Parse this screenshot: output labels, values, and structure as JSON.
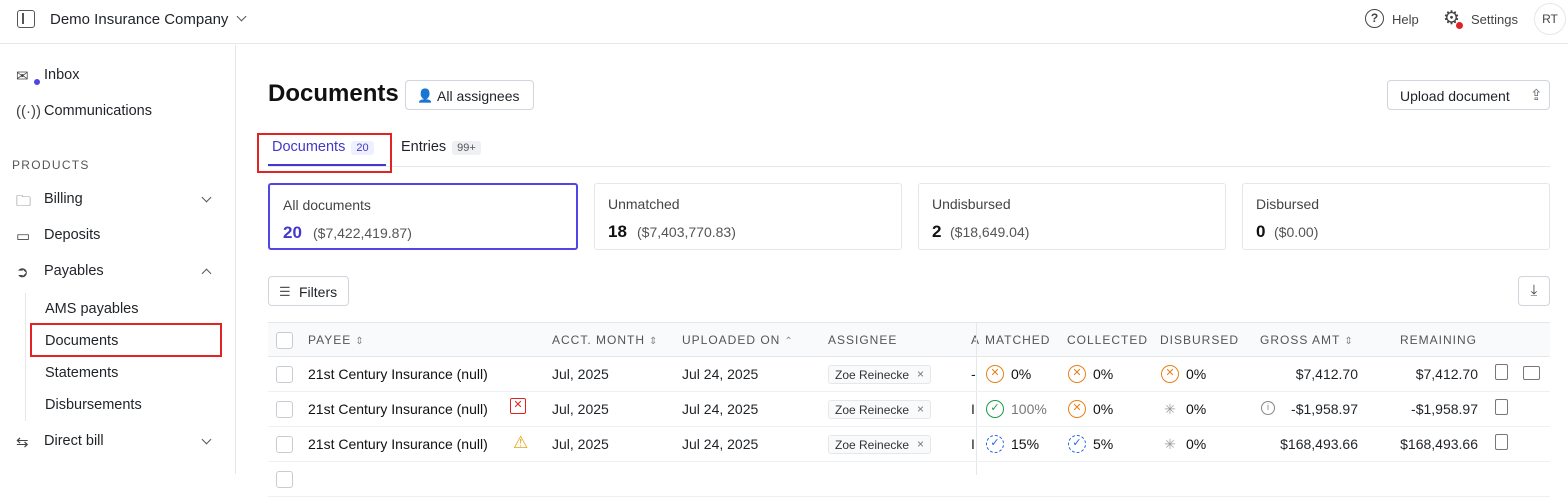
{
  "topbar": {
    "company": "Demo Insurance Company",
    "help": "Help",
    "settings": "Settings",
    "avatar": "RT"
  },
  "sidebar": {
    "inbox": "Inbox",
    "communications": "Communications",
    "section_products": "PRODUCTS",
    "billing": "Billing",
    "deposits": "Deposits",
    "payables": "Payables",
    "payables_sub": [
      "AMS payables",
      "Documents",
      "Statements",
      "Disbursements"
    ],
    "direct_bill": "Direct bill"
  },
  "page": {
    "title": "Documents",
    "assignee_filter": "All assignees",
    "upload_button": "Upload document"
  },
  "tabs": [
    {
      "label": "Documents",
      "count": "20"
    },
    {
      "label": "Entries",
      "count": "99+"
    }
  ],
  "stat_cards": [
    {
      "title": "All documents",
      "count": "20",
      "amount": "($7,422,419.87)"
    },
    {
      "title": "Unmatched",
      "count": "18",
      "amount": "($7,403,770.83)"
    },
    {
      "title": "Undisbursed",
      "count": "2",
      "amount": "($18,649.04)"
    },
    {
      "title": "Disbursed",
      "count": "0",
      "amount": "($0.00)"
    }
  ],
  "toolbar": {
    "filters": "Filters"
  },
  "table": {
    "headers": {
      "payee": "PAYEE",
      "acct_month": "ACCT. MONTH",
      "uploaded_on": "UPLOADED ON",
      "assignee": "ASSIGNEE",
      "truncated": "A",
      "matched": "MATCHED",
      "collected": "COLLECTED",
      "disbursed": "DISBURSED",
      "gross_amt": "GROSS AMT",
      "remaining": "REMAINING"
    },
    "rows": [
      {
        "payee": "21st Century Insurance (null)",
        "acct_month": "Jul, 2025",
        "uploaded_on": "Jul 24, 2025",
        "assignee": "Zoe Reinecke",
        "trunc": "-",
        "matched": "0%",
        "collected": "0%",
        "disbursed": "0%",
        "gross": "$7,412.70",
        "remaining": "$7,412.70"
      },
      {
        "payee": "21st Century Insurance (null)",
        "acct_month": "Jul, 2025",
        "uploaded_on": "Jul 24, 2025",
        "assignee": "Zoe Reinecke",
        "trunc": "I",
        "matched": "100%",
        "collected": "0%",
        "disbursed": "0%",
        "gross": "-$1,958.97",
        "remaining": "-$1,958.97"
      },
      {
        "payee": "21st Century Insurance (null)",
        "acct_month": "Jul, 2025",
        "uploaded_on": "Jul 24, 2025",
        "assignee": "Zoe Reinecke",
        "trunc": "I",
        "matched": "15%",
        "collected": "5%",
        "disbursed": "0%",
        "gross": "$168,493.66",
        "remaining": "$168,493.66"
      }
    ]
  },
  "colors": {
    "accent": "#4338ca",
    "highlight": "#e02424",
    "status_orange": "#e8811a",
    "status_green": "#1a9c4b",
    "status_blue": "#2563eb"
  }
}
